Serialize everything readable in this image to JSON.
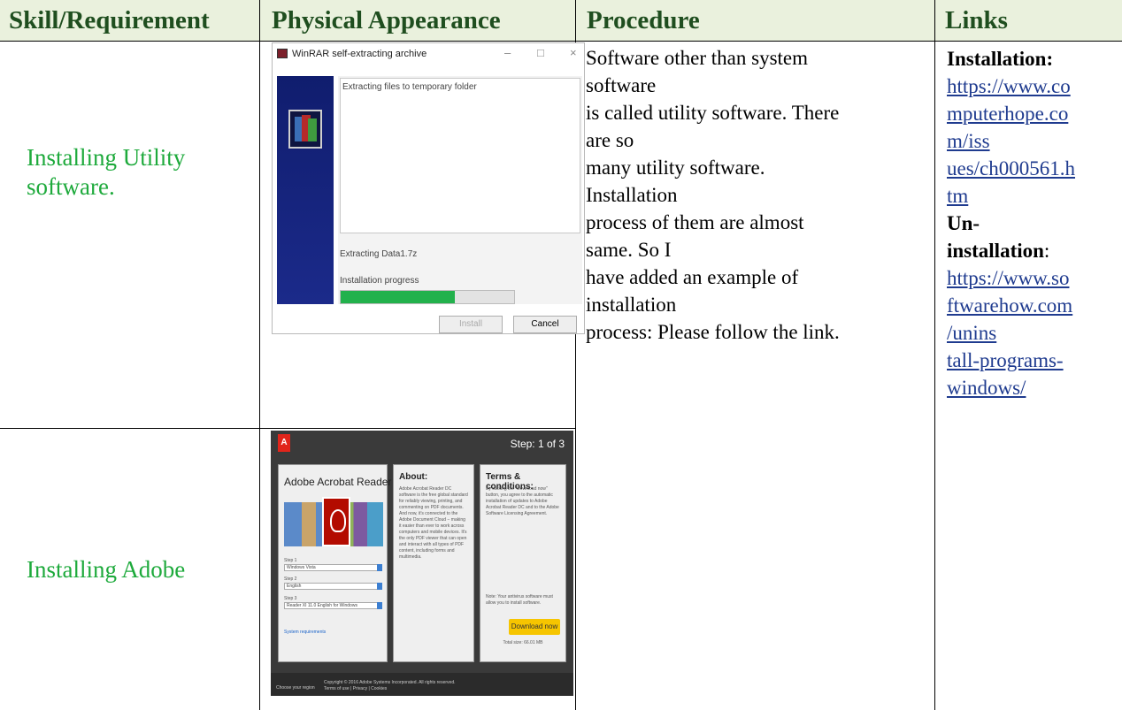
{
  "table": {
    "headers": [
      "Skill/Requirement",
      "Physical Appearance",
      "Procedure",
      "Links"
    ],
    "rows": [
      {
        "skill": "Installing Utility software."
      },
      {
        "skill": "Installing Adobe"
      }
    ],
    "procedure_lines": [
      "Software other than system",
      "software",
      "is called utility software. There",
      "are so",
      "many utility software.",
      "Installation",
      "process of them are almost",
      "same. So I",
      "have added an example of",
      "installation",
      "process: Please follow the link."
    ],
    "links": {
      "installation_label": "Installation:",
      "installation_url_lines": [
        "https://www.co",
        "mputerhope.co",
        "m/iss",
        "ues/ch000561.h",
        "tm"
      ],
      "uninstallation_label_lines": [
        "Un-",
        "installation"
      ],
      "uninstallation_colon": ":",
      "uninstallation_url_lines": [
        "https://www.so",
        "ftwarehow.com",
        "/unins",
        "tall-programs-",
        "windows/"
      ]
    }
  },
  "winrar": {
    "title": "WinRAR self-extracting archive",
    "window_controls": [
      "–",
      "□",
      "×"
    ],
    "status_text": "Extracting files to temporary folder",
    "current_file": "Extracting Data1.7z",
    "progress_label": "Installation progress",
    "progress_fraction": 0.66,
    "install_button": "Install",
    "cancel_button": "Cancel"
  },
  "adobe": {
    "logo": "A",
    "step": "Step: 1 of 3",
    "product_title": "Adobe Acrobat Reader DC",
    "about_heading": "About:",
    "about_text": "Adobe Acrobat Reader DC software is the free global standard for reliably viewing, printing, and commenting on PDF documents. And now, it's connected to the Adobe Document Cloud − making it easier than ever to work across computers and mobile devices. It's the only PDF viewer that can open and interact with all types of PDF content, including forms and multimedia.",
    "terms_heading": "Terms & conditions:",
    "terms_text": "By clicking the \"Download now\" button, you agree to the automatic installation of updates to Adobe Acrobat Reader DC and to the Adobe Software Licensing Agreement.",
    "note_text": "Note: Your antivirus software must allow you to install software.",
    "step1_label": "Step 1",
    "step1_value": "Windows Vista",
    "step2_label": "Step 2",
    "step2_value": "English",
    "step3_label": "Step 3",
    "step3_value": "Reader XI 11.0 English for Windows",
    "system_requirements": "System requirements",
    "download_button": "Download now",
    "total_size": "Total size: 66.01 MB",
    "footer_text": "Copyright © 2016 Adobe Systems Incorporated. All rights reserved. Terms of use | Privacy | Cookies",
    "footer_region": "Choose your region"
  }
}
